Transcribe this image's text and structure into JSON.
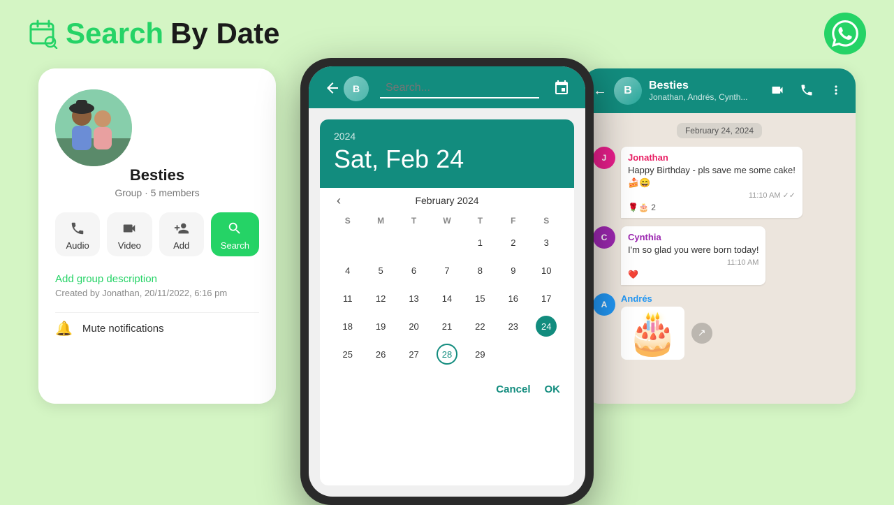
{
  "header": {
    "title_green": "Search",
    "title_dark": " By Date",
    "whatsapp_aria": "WhatsApp logo"
  },
  "left_card": {
    "group_name": "Besties",
    "group_sub": "Group · 5 members",
    "btn_audio": "Audio",
    "btn_video": "Video",
    "btn_add": "Add",
    "btn_search": "Search",
    "add_description": "Add group description",
    "created_by": "Created by Jonathan, 20/11/2022, 6:16 pm",
    "mute": "Mute notifications"
  },
  "phone": {
    "search_placeholder": "Search...",
    "calendar": {
      "year": "2024",
      "selected_date": "Sat, Feb 24",
      "month_label": "February 2024",
      "day_headers": [
        "S",
        "M",
        "T",
        "W",
        "T",
        "F",
        "S"
      ],
      "weeks": [
        [
          null,
          null,
          null,
          null,
          1,
          2,
          3
        ],
        [
          4,
          5,
          6,
          7,
          8,
          9,
          10
        ],
        [
          11,
          12,
          13,
          14,
          15,
          16,
          17
        ],
        [
          18,
          19,
          20,
          21,
          22,
          23,
          24
        ],
        [
          25,
          26,
          27,
          28,
          29,
          null,
          null
        ]
      ],
      "selected_day": 24,
      "today_day": 28,
      "btn_cancel": "Cancel",
      "btn_ok": "OK"
    }
  },
  "right_card": {
    "chat_name": "Besties",
    "chat_members": "Jonathan, Andrés, Cynth...",
    "date_divider": "February 24, 2024",
    "messages": [
      {
        "sender": "Jonathan",
        "sender_color": "jonathan",
        "text": "Happy Birthday - pls save me some cake! 🍰😄",
        "time": "11:10 AM",
        "reactions": "🌹🎂 2"
      },
      {
        "sender": "Cynthia",
        "sender_color": "cynthia",
        "text": "I'm so glad you were born today!",
        "time": "11:10 AM",
        "reactions": "❤️"
      },
      {
        "sender": "Andrés",
        "sender_color": "andres",
        "text": "",
        "time": "",
        "is_cake": true
      }
    ]
  }
}
